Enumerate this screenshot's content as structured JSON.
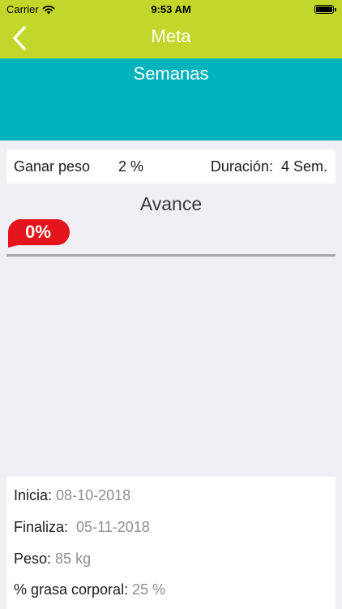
{
  "status_bar": {
    "carrier": "Carrier",
    "time": "9:53 AM",
    "wifi_icon": "wifi-icon",
    "battery_icon": "battery-icon"
  },
  "nav": {
    "back_icon": "chevron-left-icon",
    "title": "Meta"
  },
  "header": {
    "title": "Semanas"
  },
  "goal": {
    "type": "Ganar peso",
    "percent": "2 %",
    "duration_label": "Duración:",
    "duration_value": "4 Sem."
  },
  "progress": {
    "title": "Avance",
    "label": "0%",
    "fraction": 0
  },
  "details": {
    "start_label": "Inicia:",
    "start_value": "08-10-2018",
    "end_label": "Finaliza:",
    "end_value": "05-11-2018",
    "weight_label": "Peso:",
    "weight_value": "85 kg",
    "bodyfat_label": "% grasa corporal:",
    "bodyfat_value": "25 %"
  },
  "colors": {
    "nav_bar": "#c3d72a",
    "header": "#00b2bc",
    "progress_bubble": "#e3141b",
    "background": "#efeff4"
  }
}
